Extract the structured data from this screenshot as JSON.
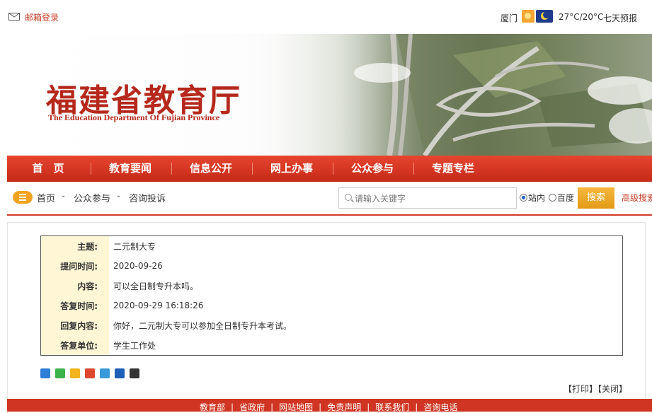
{
  "topbar": {
    "mail_label": "邮箱登录",
    "city": "厦门",
    "temperature": "27°C/20°C",
    "forecast_label": "七天预报"
  },
  "banner": {
    "title": "福建省教育厅",
    "subtitle": "The Education Department Of Fujian Province"
  },
  "nav": {
    "items": [
      "首　页",
      "教育要闻",
      "信息公开",
      "网上办事",
      "公众参与",
      "专题专栏"
    ]
  },
  "breadcrumb": {
    "items": [
      "首页",
      "公众参与",
      "咨询投诉"
    ],
    "separator": "-"
  },
  "search": {
    "placeholder": "请输入关键字",
    "scope_site": "站内",
    "scope_baidu": "百度",
    "selected_scope": "站内",
    "button": "搜索",
    "advanced": "高级搜索"
  },
  "qa": {
    "rows": [
      {
        "label": "主题:",
        "value": "二元制大专"
      },
      {
        "label": "提问时间:",
        "value": "2020-09-26"
      },
      {
        "label": "内容:",
        "value": "可以全日制专升本吗。"
      },
      {
        "label": "答复时间:",
        "value": "2020-09-29 16:18:26"
      },
      {
        "label": "回复内容:",
        "value": "你好，二元制大专可以参加全日制专升本考试。"
      },
      {
        "label": "答复单位:",
        "value": "学生工作处"
      }
    ]
  },
  "actions": {
    "print": "【打印】",
    "close": "【关闭】"
  },
  "share_icons": [
    "share-plus-icon",
    "wechat-icon",
    "qzone-icon",
    "weibo-icon",
    "tencent-weibo-icon",
    "renren-icon",
    "qq-icon"
  ],
  "footer": {
    "links": [
      "教育部",
      "省政府",
      "网站地图",
      "免责声明",
      "联系我们",
      "咨询电话"
    ]
  },
  "colors": {
    "brand_red": "#c52a18",
    "accent_orange": "#f1a320",
    "label_bg": "#fff6d6"
  }
}
